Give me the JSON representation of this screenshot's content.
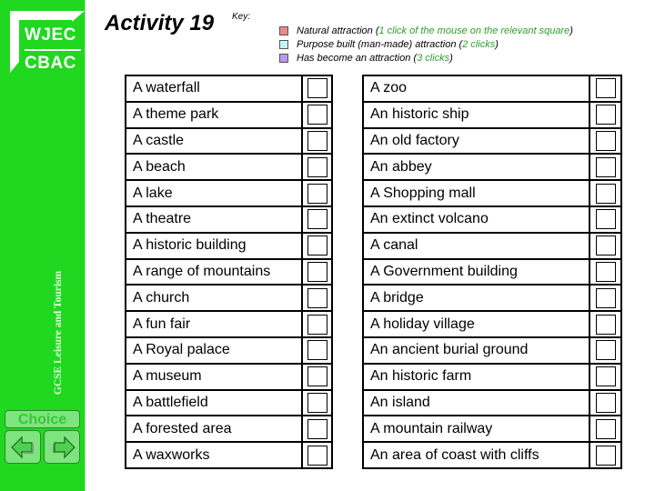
{
  "logo": {
    "line1": "WJEC",
    "line2": "CBAC"
  },
  "sidebar": {
    "subject": "GCSE Leisure and Tourism",
    "choice_label": "Choice",
    "prev_icon": "arrow-left-icon",
    "next_icon": "arrow-right-icon",
    "color": "#1fd81f"
  },
  "header": {
    "title": "Activity 19",
    "key_label": "Key:"
  },
  "legend": [
    {
      "text": "Natural attraction (",
      "hint": "1 click of the mouse on the relevant square",
      "close": ")",
      "color": "#f08a8a"
    },
    {
      "text": "Purpose built (man-made) attraction (",
      "hint": "2 clicks",
      "close": ")",
      "color": "#c8f4f4"
    },
    {
      "text": "Has become an attraction (",
      "hint": "3 clicks",
      "close": ")",
      "color": "#b89af0"
    }
  ],
  "left_items": [
    "A waterfall",
    "A theme park",
    "A castle",
    "A beach",
    "A lake",
    "A theatre",
    "A historic building",
    "A range of mountains",
    "A church",
    "A fun fair",
    "A Royal palace",
    "A museum",
    "A battlefield",
    "A forested area",
    "A waxworks"
  ],
  "right_items": [
    "A zoo",
    "An historic ship",
    "An old factory",
    "An abbey",
    "A Shopping mall",
    "An extinct volcano",
    "A canal",
    "A Government building",
    "A bridge",
    "A holiday village",
    "An ancient burial ground",
    "An historic farm",
    "An island",
    "A mountain railway",
    "An area of coast with cliffs"
  ]
}
